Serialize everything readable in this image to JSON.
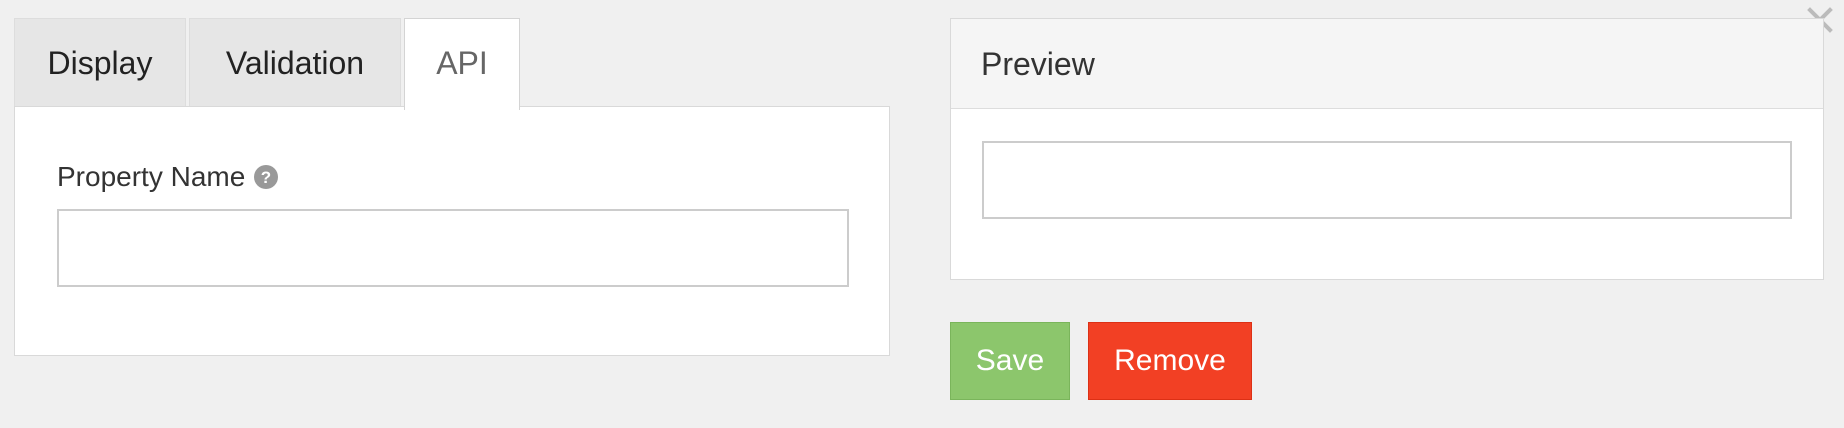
{
  "dialog": {
    "close_icon": "close-icon"
  },
  "tabs": [
    {
      "label": "Display",
      "active": false
    },
    {
      "label": "Validation",
      "active": false
    },
    {
      "label": "API",
      "active": true
    }
  ],
  "api_panel": {
    "property_name_label": "Property Name",
    "help_icon": "question-circle-icon",
    "property_name_value": ""
  },
  "preview": {
    "title": "Preview",
    "input_value": ""
  },
  "actions": {
    "save_label": "Save",
    "remove_label": "Remove"
  },
  "colors": {
    "save": "#8cc66c",
    "remove": "#f24024",
    "background": "#f0f0f0"
  }
}
